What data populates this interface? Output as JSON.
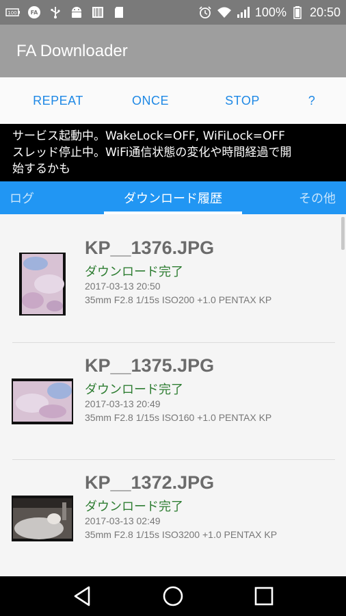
{
  "status_bar": {
    "battery_percent": "100%",
    "time": "20:50",
    "icons": [
      "battery-100-icon",
      "fa-icon",
      "usb-icon",
      "android-icon",
      "barcode-icon",
      "sd-card-icon",
      "alarm-icon",
      "wifi-icon",
      "signal-icon",
      "battery-icon"
    ]
  },
  "app": {
    "title": "FA Downloader"
  },
  "controls": {
    "repeat": "REPEAT",
    "once": "ONCE",
    "stop": "STOP",
    "help": "?"
  },
  "status_message": {
    "line1": "サービス起動中。WakeLock=OFF, WiFiLock=OFF",
    "line2": "スレッド停止中。WiFi通信状態の変化や時間経過で開",
    "line3": "始するかも"
  },
  "tabs": [
    {
      "label": "ログ",
      "active": false
    },
    {
      "label": "ダウンロード履歴",
      "active": true
    },
    {
      "label": "その他",
      "active": false
    }
  ],
  "downloads": [
    {
      "name": "KP__1376.JPG",
      "status": "ダウンロード完了",
      "date": "2017-03-13 20:50",
      "info": "35mm F2.8 1/15s ISO200 +1.0 PENTAX KP"
    },
    {
      "name": "KP__1375.JPG",
      "status": "ダウンロード完了",
      "date": "2017-03-13 20:49",
      "info": "35mm F2.8 1/15s ISO160 +1.0 PENTAX KP"
    },
    {
      "name": "KP__1372.JPG",
      "status": "ダウンロード完了",
      "date": "2017-03-13 02:49",
      "info": "35mm F2.8 1/15s ISO3200 +1.0 PENTAX KP"
    }
  ],
  "colors": {
    "accent": "#2196f3",
    "button_text": "#1e88e5",
    "success": "#2e7d32",
    "app_bar": "#9e9e9e",
    "status_bar": "#7a7a7a"
  }
}
